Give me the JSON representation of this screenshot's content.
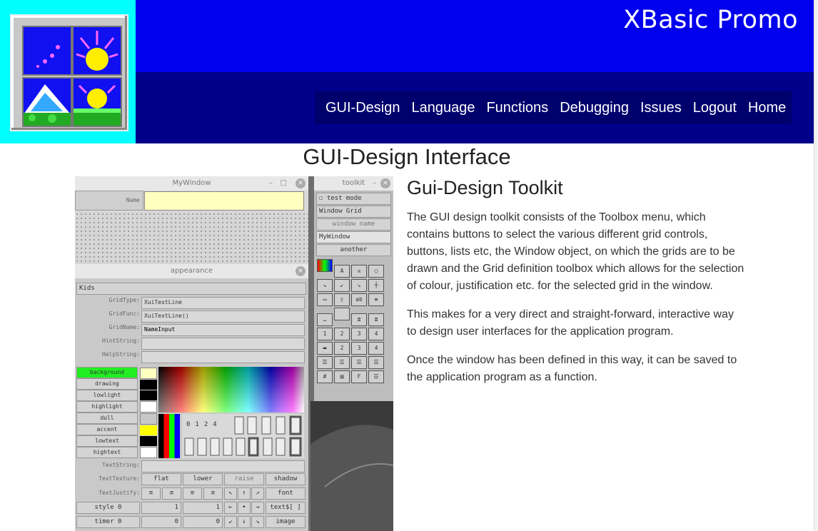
{
  "header": {
    "site_title": "XBasic Promo",
    "nav": [
      "GUI-Design",
      "Language",
      "Functions",
      "Debugging",
      "Issues",
      "Logout",
      "Home"
    ]
  },
  "page": {
    "title": "GUI-Design Interface"
  },
  "article": {
    "heading": "Gui-Design Toolkit",
    "paragraphs": [
      "The GUI design toolkit consists of the Toolbox menu, which contains buttons to select the various different grid controls, buttons, lists etc, the Window object, on which the grids are to be drawn and the Grid definition toolbox which allows for the selection of colour, justification etc. for the selected grid in the window.",
      "This makes for a very direct and straight-forward, interactive way to design user interfaces for the application program.",
      "Once the window has been defined in this way, it can be saved to the application program as a function."
    ]
  },
  "screenshot": {
    "mywindow": {
      "title": "MyWindow",
      "name_label": "Name"
    },
    "toolkit": {
      "title": "toolkit",
      "rows": [
        "test mode",
        "Window  Grid",
        "window name",
        "MyWindow",
        "another"
      ]
    },
    "appearance": {
      "title": "appearance",
      "kids": "Kids",
      "fields": [
        {
          "label": "GridType:",
          "value": "XuiTextLine"
        },
        {
          "label": "GridFunc:",
          "value": "XuiTextLine()"
        },
        {
          "label": "GridName:",
          "value": "NameInput"
        },
        {
          "label": "HintString:",
          "value": ""
        },
        {
          "label": "HelpString:",
          "value": ""
        }
      ],
      "colors": [
        "background",
        "drawing",
        "lowlight",
        "highlight",
        "dull",
        "accent",
        "lowtext",
        "hightext"
      ],
      "textstring": "TextString:",
      "texture_label": "TextTexture:",
      "textures": [
        "flat",
        "lower",
        "raise",
        "shadow"
      ],
      "justify_label": "TextJustify:",
      "font_btn": "font",
      "style_label": "style",
      "timer_label": "timer",
      "text_btn": "text$[ ]",
      "image_btn": "image",
      "nums": [
        "0",
        "1",
        "2",
        "4"
      ]
    }
  }
}
